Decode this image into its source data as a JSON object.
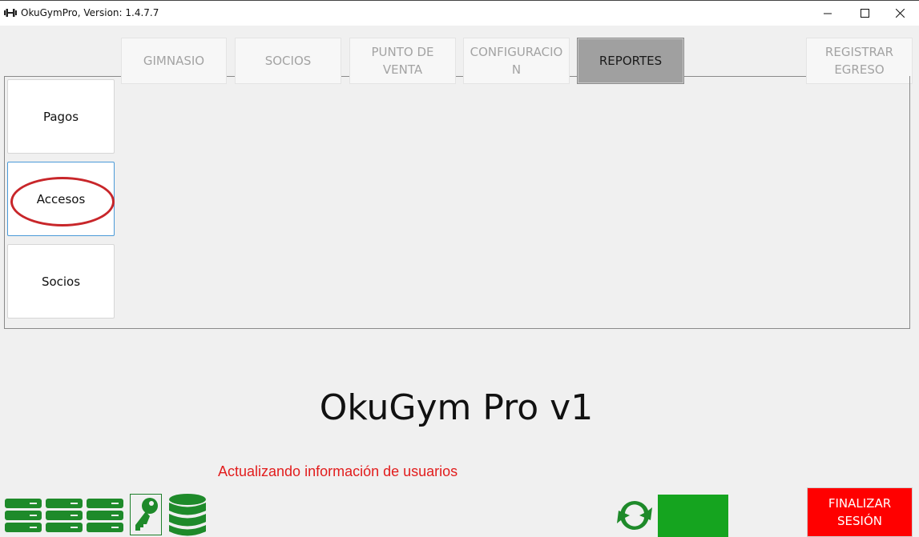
{
  "window": {
    "title": "OkuGymPro, Version: 1.4.7.7"
  },
  "tabs": [
    {
      "label": "GIMNASIO",
      "active": false
    },
    {
      "label": "SOCIOS",
      "active": false
    },
    {
      "label": "PUNTO DE\nVENTA",
      "active": false
    },
    {
      "label": "CONFIGURACIO\nN",
      "active": false
    },
    {
      "label": "REPORTES",
      "active": true
    }
  ],
  "register_expense": {
    "label": "REGISTRAR\nEGRESO"
  },
  "reports_menu": {
    "items": [
      {
        "label": "Pagos",
        "selected": false
      },
      {
        "label": "Accesos",
        "selected": true,
        "highlighted": true
      },
      {
        "label": "Socios",
        "selected": false
      }
    ]
  },
  "brand": {
    "title": "OkuGym Pro v1"
  },
  "status": {
    "message": "Actualizando información de usuarios"
  },
  "status_bar": {
    "icons": [
      "server-icon",
      "server-icon",
      "server-icon",
      "key-icon",
      "database-icon",
      "sync-icon"
    ],
    "connection_color": "#15a41f"
  },
  "logout": {
    "label": "FINALIZAR\nSESIÓN"
  },
  "colors": {
    "accent_green": "#1e8a2a",
    "status_red": "#e21d1d",
    "logout_red": "#ff0000",
    "active_tab": "#a0a0a0",
    "highlight_ring": "#c8262a"
  }
}
